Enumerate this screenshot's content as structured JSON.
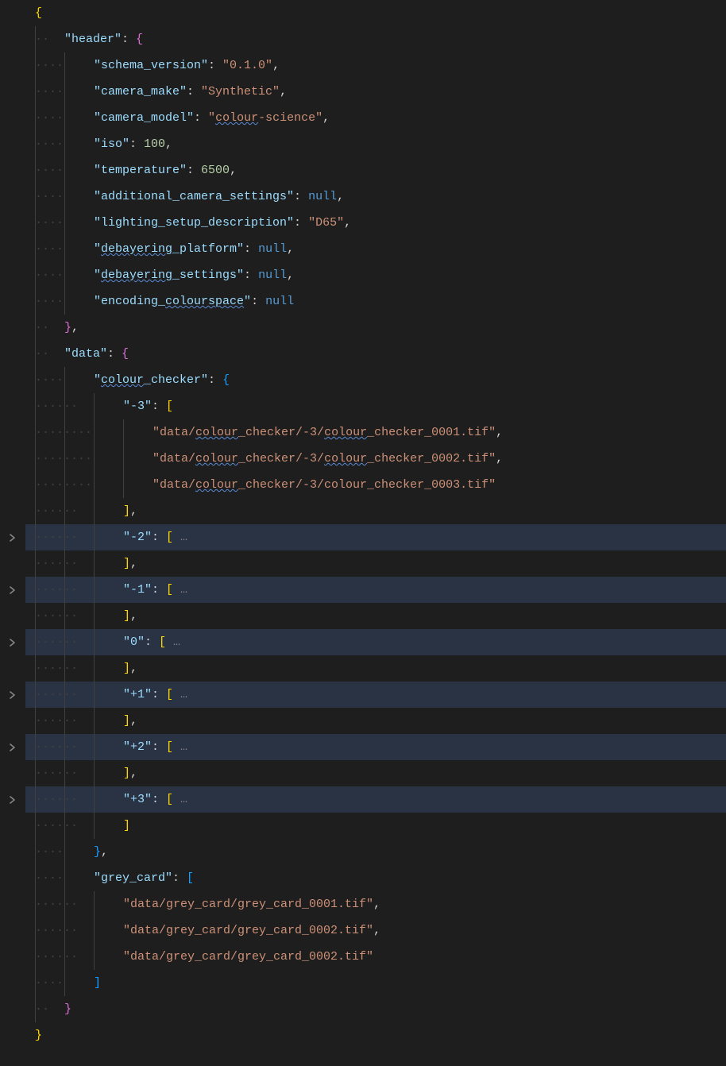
{
  "lines": [
    {
      "fold": false,
      "hl": false,
      "indent": 0,
      "guides": [],
      "tokens": [
        [
          "brace-a",
          "{"
        ]
      ]
    },
    {
      "fold": false,
      "hl": false,
      "indent": 1,
      "guides": [
        0
      ],
      "tokens": [
        [
          "key",
          "\"header\""
        ],
        [
          "colon",
          ": "
        ],
        [
          "brace-b",
          "{"
        ]
      ]
    },
    {
      "fold": false,
      "hl": false,
      "indent": 2,
      "guides": [
        0,
        1
      ],
      "tokens": [
        [
          "key",
          "\"schema_version\""
        ],
        [
          "colon",
          ": "
        ],
        [
          "str",
          "\"0.1.0\""
        ],
        [
          "comma",
          ","
        ]
      ]
    },
    {
      "fold": false,
      "hl": false,
      "indent": 2,
      "guides": [
        0,
        1
      ],
      "tokens": [
        [
          "key",
          "\"camera_make\""
        ],
        [
          "colon",
          ": "
        ],
        [
          "str",
          "\"Synthetic\""
        ],
        [
          "comma",
          ","
        ]
      ]
    },
    {
      "fold": false,
      "hl": false,
      "indent": 2,
      "guides": [
        0,
        1
      ],
      "tokens": [
        [
          "key",
          "\"camera_model\""
        ],
        [
          "colon",
          ": "
        ],
        [
          "str",
          "\""
        ],
        [
          "str sqerr",
          "colour"
        ],
        [
          "str",
          "-science\""
        ],
        [
          "comma",
          ","
        ]
      ]
    },
    {
      "fold": false,
      "hl": false,
      "indent": 2,
      "guides": [
        0,
        1
      ],
      "tokens": [
        [
          "key",
          "\"iso\""
        ],
        [
          "colon",
          ": "
        ],
        [
          "num",
          "100"
        ],
        [
          "comma",
          ","
        ]
      ]
    },
    {
      "fold": false,
      "hl": false,
      "indent": 2,
      "guides": [
        0,
        1
      ],
      "tokens": [
        [
          "key",
          "\"temperature\""
        ],
        [
          "colon",
          ": "
        ],
        [
          "num",
          "6500"
        ],
        [
          "comma",
          ","
        ]
      ]
    },
    {
      "fold": false,
      "hl": false,
      "indent": 2,
      "guides": [
        0,
        1
      ],
      "tokens": [
        [
          "key",
          "\"additional_camera_settings\""
        ],
        [
          "colon",
          ": "
        ],
        [
          "nul",
          "null"
        ],
        [
          "comma",
          ","
        ]
      ]
    },
    {
      "fold": false,
      "hl": false,
      "indent": 2,
      "guides": [
        0,
        1
      ],
      "tokens": [
        [
          "key",
          "\"lighting_setup_description\""
        ],
        [
          "colon",
          ": "
        ],
        [
          "str",
          "\"D65\""
        ],
        [
          "comma",
          ","
        ]
      ]
    },
    {
      "fold": false,
      "hl": false,
      "indent": 2,
      "guides": [
        0,
        1
      ],
      "tokens": [
        [
          "key",
          "\""
        ],
        [
          "key sqerr",
          "debayering"
        ],
        [
          "key",
          "_platform\""
        ],
        [
          "colon",
          ": "
        ],
        [
          "nul",
          "null"
        ],
        [
          "comma",
          ","
        ]
      ]
    },
    {
      "fold": false,
      "hl": false,
      "indent": 2,
      "guides": [
        0,
        1
      ],
      "tokens": [
        [
          "key",
          "\""
        ],
        [
          "key sqerr",
          "debayering"
        ],
        [
          "key",
          "_settings\""
        ],
        [
          "colon",
          ": "
        ],
        [
          "nul",
          "null"
        ],
        [
          "comma",
          ","
        ]
      ]
    },
    {
      "fold": false,
      "hl": false,
      "indent": 2,
      "guides": [
        0,
        1
      ],
      "tokens": [
        [
          "key",
          "\"encoding_"
        ],
        [
          "key sqerr",
          "colourspace"
        ],
        [
          "key",
          "\""
        ],
        [
          "colon",
          ": "
        ],
        [
          "nul",
          "null"
        ]
      ]
    },
    {
      "fold": false,
      "hl": false,
      "indent": 1,
      "guides": [
        0
      ],
      "tokens": [
        [
          "brace-b",
          "}"
        ],
        [
          "comma",
          ","
        ]
      ]
    },
    {
      "fold": false,
      "hl": false,
      "indent": 1,
      "guides": [
        0
      ],
      "tokens": [
        [
          "key",
          "\"data\""
        ],
        [
          "colon",
          ": "
        ],
        [
          "brace-b",
          "{"
        ]
      ]
    },
    {
      "fold": false,
      "hl": false,
      "indent": 2,
      "guides": [
        0,
        1
      ],
      "tokens": [
        [
          "key",
          "\""
        ],
        [
          "key sqerr",
          "colour"
        ],
        [
          "key",
          "_checker\""
        ],
        [
          "colon",
          ": "
        ],
        [
          "brace-c",
          "{"
        ]
      ]
    },
    {
      "fold": false,
      "hl": false,
      "indent": 3,
      "guides": [
        0,
        1,
        2
      ],
      "tokens": [
        [
          "key",
          "\"-3\""
        ],
        [
          "colon",
          ": "
        ],
        [
          "brace-d",
          "["
        ]
      ]
    },
    {
      "fold": false,
      "hl": false,
      "indent": 4,
      "guides": [
        0,
        1,
        2,
        3
      ],
      "tokens": [
        [
          "str",
          "\"data/"
        ],
        [
          "str sqerr",
          "colour"
        ],
        [
          "str",
          "_checker/-3/"
        ],
        [
          "str sqerr",
          "colour"
        ],
        [
          "str",
          "_checker_0001.tif\""
        ],
        [
          "comma",
          ","
        ]
      ]
    },
    {
      "fold": false,
      "hl": false,
      "indent": 4,
      "guides": [
        0,
        1,
        2,
        3
      ],
      "tokens": [
        [
          "str",
          "\"data/"
        ],
        [
          "str sqerr",
          "colour"
        ],
        [
          "str",
          "_checker/-3/"
        ],
        [
          "str sqerr",
          "colour"
        ],
        [
          "str",
          "_checker_0002.tif\""
        ],
        [
          "comma",
          ","
        ]
      ]
    },
    {
      "fold": false,
      "hl": false,
      "indent": 4,
      "guides": [
        0,
        1,
        2,
        3
      ],
      "tokens": [
        [
          "str",
          "\"data/"
        ],
        [
          "str sqerr",
          "colour"
        ],
        [
          "str",
          "_checker/-3/colour_checker_0003.tif\""
        ]
      ]
    },
    {
      "fold": false,
      "hl": false,
      "indent": 3,
      "guides": [
        0,
        1,
        2
      ],
      "tokens": [
        [
          "brace-d",
          "]"
        ],
        [
          "comma",
          ","
        ]
      ]
    },
    {
      "fold": true,
      "hl": true,
      "indent": 3,
      "guides": [
        0,
        1,
        2
      ],
      "tokens": [
        [
          "key",
          "\"-2\""
        ],
        [
          "colon",
          ": "
        ],
        [
          "brace-d",
          "["
        ],
        [
          "fold",
          " …"
        ]
      ]
    },
    {
      "fold": false,
      "hl": false,
      "indent": 3,
      "guides": [
        0,
        1,
        2
      ],
      "tokens": [
        [
          "brace-d",
          "]"
        ],
        [
          "comma",
          ","
        ]
      ]
    },
    {
      "fold": true,
      "hl": true,
      "indent": 3,
      "guides": [
        0,
        1,
        2
      ],
      "tokens": [
        [
          "key",
          "\"-1\""
        ],
        [
          "colon",
          ": "
        ],
        [
          "brace-d",
          "["
        ],
        [
          "fold",
          " …"
        ]
      ]
    },
    {
      "fold": false,
      "hl": false,
      "indent": 3,
      "guides": [
        0,
        1,
        2
      ],
      "tokens": [
        [
          "brace-d",
          "]"
        ],
        [
          "comma",
          ","
        ]
      ]
    },
    {
      "fold": true,
      "hl": true,
      "indent": 3,
      "guides": [
        0,
        1,
        2
      ],
      "tokens": [
        [
          "key",
          "\"0\""
        ],
        [
          "colon",
          ": "
        ],
        [
          "brace-d",
          "["
        ],
        [
          "fold",
          " …"
        ]
      ]
    },
    {
      "fold": false,
      "hl": false,
      "indent": 3,
      "guides": [
        0,
        1,
        2
      ],
      "tokens": [
        [
          "brace-d",
          "]"
        ],
        [
          "comma",
          ","
        ]
      ]
    },
    {
      "fold": true,
      "hl": true,
      "indent": 3,
      "guides": [
        0,
        1,
        2
      ],
      "tokens": [
        [
          "key",
          "\"+1\""
        ],
        [
          "colon",
          ": "
        ],
        [
          "brace-d",
          "["
        ],
        [
          "fold",
          " …"
        ]
      ]
    },
    {
      "fold": false,
      "hl": false,
      "indent": 3,
      "guides": [
        0,
        1,
        2
      ],
      "tokens": [
        [
          "brace-d",
          "]"
        ],
        [
          "comma",
          ","
        ]
      ]
    },
    {
      "fold": true,
      "hl": true,
      "indent": 3,
      "guides": [
        0,
        1,
        2
      ],
      "tokens": [
        [
          "key",
          "\"+2\""
        ],
        [
          "colon",
          ": "
        ],
        [
          "brace-d",
          "["
        ],
        [
          "fold",
          " …"
        ]
      ]
    },
    {
      "fold": false,
      "hl": false,
      "indent": 3,
      "guides": [
        0,
        1,
        2
      ],
      "tokens": [
        [
          "brace-d",
          "]"
        ],
        [
          "comma",
          ","
        ]
      ]
    },
    {
      "fold": true,
      "hl": true,
      "indent": 3,
      "guides": [
        0,
        1,
        2
      ],
      "tokens": [
        [
          "key",
          "\"+3\""
        ],
        [
          "colon",
          ": "
        ],
        [
          "brace-d",
          "["
        ],
        [
          "fold",
          " …"
        ]
      ]
    },
    {
      "fold": false,
      "hl": false,
      "indent": 3,
      "guides": [
        0,
        1,
        2
      ],
      "tokens": [
        [
          "brace-d",
          "]"
        ]
      ]
    },
    {
      "fold": false,
      "hl": false,
      "indent": 2,
      "guides": [
        0,
        1
      ],
      "tokens": [
        [
          "brace-c",
          "}"
        ],
        [
          "comma",
          ","
        ]
      ]
    },
    {
      "fold": false,
      "hl": false,
      "indent": 2,
      "guides": [
        0,
        1
      ],
      "tokens": [
        [
          "key",
          "\"grey_card\""
        ],
        [
          "colon",
          ": "
        ],
        [
          "brace-c",
          "["
        ]
      ]
    },
    {
      "fold": false,
      "hl": false,
      "indent": 3,
      "guides": [
        0,
        1,
        2
      ],
      "tokens": [
        [
          "str",
          "\"data/grey_card/grey_card_0001.tif\""
        ],
        [
          "comma",
          ","
        ]
      ]
    },
    {
      "fold": false,
      "hl": false,
      "indent": 3,
      "guides": [
        0,
        1,
        2
      ],
      "tokens": [
        [
          "str",
          "\"data/grey_card/grey_card_0002.tif\""
        ],
        [
          "comma",
          ","
        ]
      ]
    },
    {
      "fold": false,
      "hl": false,
      "indent": 3,
      "guides": [
        0,
        1,
        2
      ],
      "tokens": [
        [
          "str",
          "\"data/grey_card/grey_card_0002.tif\""
        ]
      ]
    },
    {
      "fold": false,
      "hl": false,
      "indent": 2,
      "guides": [
        0,
        1
      ],
      "tokens": [
        [
          "brace-c",
          "]"
        ]
      ]
    },
    {
      "fold": false,
      "hl": false,
      "indent": 1,
      "guides": [
        0
      ],
      "tokens": [
        [
          "brace-b",
          "}"
        ]
      ]
    },
    {
      "fold": false,
      "hl": false,
      "indent": 0,
      "guides": [],
      "tokens": [
        [
          "brace-a",
          "}"
        ]
      ]
    }
  ],
  "indentUnit": 2,
  "indentPx": 18.5,
  "indentDot": "·"
}
